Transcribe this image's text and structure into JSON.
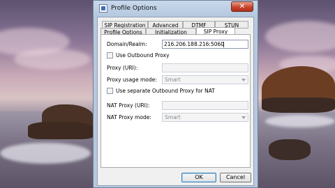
{
  "window": {
    "title": "Profile Options"
  },
  "tabs": {
    "row1": [
      "SIP Registration",
      "Advanced",
      "DTMF",
      "STUN"
    ],
    "row2": [
      "Profile Options",
      "Initialization",
      "SIP Proxy"
    ],
    "active": "SIP Proxy"
  },
  "form": {
    "domain_label": "Domain/Realm:",
    "domain_value": "216.206.188.216:5060",
    "use_outbound_proxy": "Use Outbound Proxy",
    "proxy_uri_label": "Proxy (URI):",
    "proxy_usage_label": "Proxy usage mode:",
    "proxy_usage_value": "Smart",
    "use_separate_nat": "Use separate Outbound Proxy for NAT",
    "nat_proxy_label": "NAT Proxy (URI):",
    "nat_mode_label": "NAT Proxy mode:",
    "nat_mode_value": "Smart"
  },
  "buttons": {
    "ok": "OK",
    "cancel": "Cancel"
  },
  "icons": {
    "app": "profile-app-icon",
    "close": "close-icon"
  }
}
